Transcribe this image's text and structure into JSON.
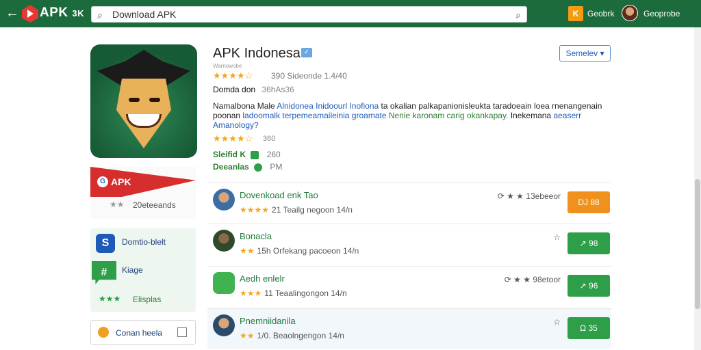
{
  "header": {
    "back_icon": "arrow-left-icon",
    "logo_text": "APK",
    "logo_suffix": "3K",
    "search_placeholder": "Download APK",
    "user1_icon_text": "K",
    "user1_label": "Geobrk",
    "user2_label": "Geoprobe"
  },
  "app": {
    "title": "APK Indonesa",
    "verified_badge": "✓",
    "subtitle": "Warnowobe",
    "rating_stars": "★★★★☆",
    "rating_text": "390 Sideonde 1.4/40",
    "download_label": "Domda don",
    "download_size": "36hAs36",
    "description": {
      "part1": "Namalbona Male ",
      "part2": "Alnidonea Inidoourl Inofiona",
      "part3": " ta okalian palkapanionisleukta taradoeain loea rnenangenain poonan ",
      "part4": "ladoomalk terpemeamaileinia groamate ",
      "part5": "Nenie karonam carig okankapay.",
      "part6": " Inekemana ",
      "part7": "aeaserr Amanology?"
    },
    "rating2_stars": "★★★★☆",
    "rating2_text": "360",
    "meta1_label": "Sleifid K",
    "meta1_value": "260",
    "meta2_label": "Deeanlas",
    "meta2_value": "PM"
  },
  "similar_button": "Semelev ▾",
  "promo": {
    "circle": "G",
    "label": "APK",
    "stars": "★★",
    "text": "20eteeands"
  },
  "side_panel": {
    "item1_label": "Domtio-blelt",
    "item2_label": "Kiage",
    "stars": "★★★",
    "item3_label": "Elisplas"
  },
  "bottom_button": {
    "label": "Conan heela"
  },
  "list": [
    {
      "name": "Dovenkoad enk Tao",
      "stars": "★★★★",
      "info": "21 Teailg negoon 14/n",
      "right": "⟳  ★ ★ 13ebeeor",
      "button": "DJ  88",
      "button_style": "orange"
    },
    {
      "name": "Bonacla",
      "stars": "★★",
      "info": "15h Orfekang pacoeon 14/n",
      "right": "☆",
      "button": "↗  98",
      "button_style": "green"
    },
    {
      "name": "Aedh enlelr",
      "stars": "★★★",
      "info": "11 Teaalingongon 14/n",
      "right": "⟳  ★ ★ 98etoor",
      "button": "↗  96",
      "button_style": "green"
    },
    {
      "name": "Pnemniidanila",
      "stars": "★★",
      "info": "1/0. Beaolngengon 14/n",
      "right": "☆",
      "button": "Ω  35",
      "button_style": "green"
    }
  ]
}
